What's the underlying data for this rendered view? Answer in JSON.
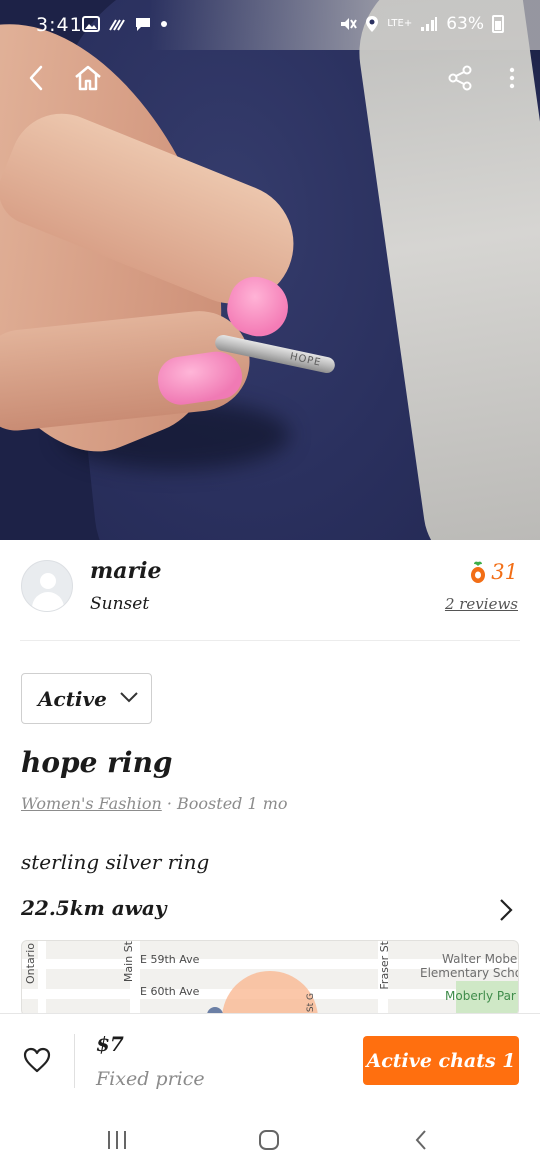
{
  "status_bar": {
    "time": "3:41",
    "network": "LTE+",
    "battery": "63%"
  },
  "topbar": {
    "back_icon": "chevron-left-icon",
    "home_icon": "home-icon",
    "share_icon": "share-icon",
    "more_icon": "more-vertical-icon"
  },
  "photo": {
    "ring_text": "HOPE"
  },
  "seller": {
    "name": "marie",
    "location": "Sunset",
    "score": "31",
    "reviews": "2 reviews"
  },
  "listing": {
    "status": "Active",
    "title": "hope ring",
    "category": "Women's Fashion",
    "meta_suffix": " · Boosted 1 mo",
    "description": "sterling silver ring",
    "distance": "22.5km away"
  },
  "map": {
    "labels": {
      "ontario": "Ontario",
      "main": "Main St",
      "e59": "E 59th Ave",
      "e60": "E 60th Ave",
      "fraser": "Fraser St",
      "school": "Walter Moberly Elementary School",
      "school_line1": "Walter Mobe",
      "school_line2": "Elementary Scho",
      "park": "Moberly Par",
      "stg": "St G"
    }
  },
  "bottom_bar": {
    "price": "$7",
    "price_type": "Fixed price",
    "chat_button": "Active chats 1"
  },
  "colors": {
    "accent": "#ff6f0f",
    "text": "#1b1b1b",
    "muted": "#8a8a8a"
  }
}
